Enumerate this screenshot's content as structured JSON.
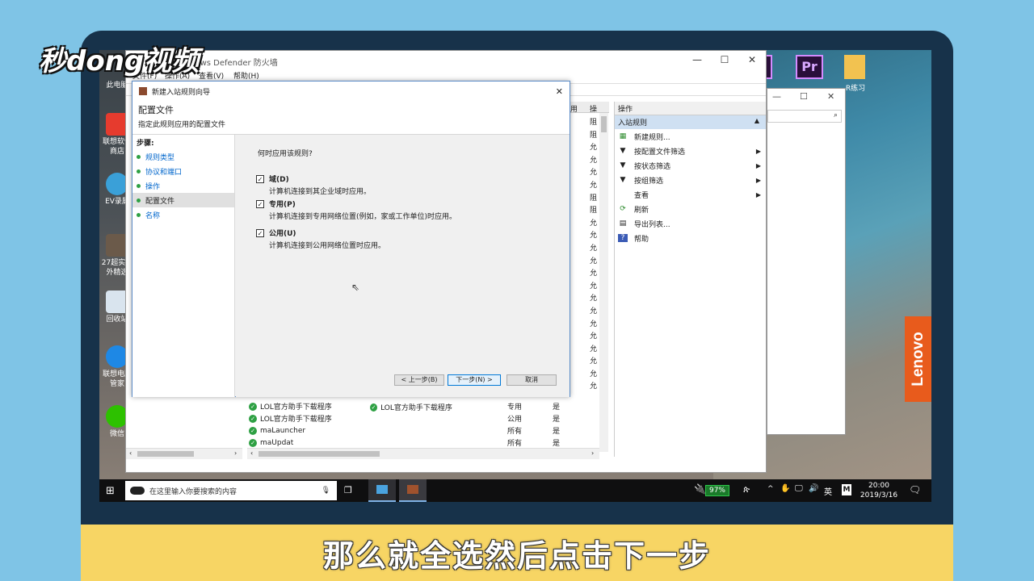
{
  "watermark": "秒dong视频",
  "subtitle": "那么就全选然后点击下一步",
  "brand": "Lenovo",
  "desktop_icons": [
    {
      "label": "此电脑"
    },
    {
      "label": "联想软件商店"
    },
    {
      "label": "EV录屏"
    },
    {
      "label": "27超实用外精选"
    },
    {
      "label": "回收站"
    },
    {
      "label": "联想电脑管家"
    },
    {
      "label": "微信"
    }
  ],
  "pr_icon": "Pr",
  "file_icon_label": "R练习",
  "main_window": {
    "title": "indows Defender 防火墙",
    "menu": [
      "文件(F)",
      "操作(A)",
      "查看(V)",
      "帮助(H)"
    ],
    "controls": {
      "min": "—",
      "max": "☐",
      "close": "✕"
    }
  },
  "actions_pane": {
    "header": "操作",
    "section": "入站规则",
    "items": [
      {
        "label": "新建规则...",
        "icon": "new-rule-icon"
      },
      {
        "label": "按配置文件筛选",
        "icon": "filter-icon",
        "arrow": "▶"
      },
      {
        "label": "按状态筛选",
        "icon": "filter-icon",
        "arrow": "▶"
      },
      {
        "label": "按组筛选",
        "icon": "filter-icon",
        "arrow": "▶"
      },
      {
        "label": "查看",
        "icon": "view-icon",
        "arrow": "▶"
      },
      {
        "label": "刷新",
        "icon": "refresh-icon"
      },
      {
        "label": "导出列表...",
        "icon": "export-icon"
      },
      {
        "label": "帮助",
        "icon": "help-icon"
      }
    ]
  },
  "list_header": {
    "col_a": "用",
    "col_b": "操"
  },
  "list_partial_actions": [
    "阻",
    "阻",
    "允",
    "允",
    "允",
    "允",
    "阻",
    "阻",
    "允",
    "允",
    "允",
    "允",
    "允",
    "允",
    "允",
    "允",
    "允",
    "允",
    "允",
    "允",
    "允",
    "允"
  ],
  "list_rows": [
    {
      "name": "LOL官方助手下载程序",
      "profile": "专用",
      "enabled": "是"
    },
    {
      "name": "LOL官方助手下载程序",
      "profile": "公用",
      "enabled": "是"
    },
    {
      "name": "maLauncher",
      "profile": "所有",
      "enabled": "是"
    },
    {
      "name": "maUpdat",
      "profile": "所有",
      "enabled": "是"
    }
  ],
  "dialog": {
    "title": "新建入站规则向导",
    "heading": "配置文件",
    "subheading": "指定此规则应用的配置文件",
    "steps_label": "步骤:",
    "steps": [
      "规则类型",
      "协议和端口",
      "操作",
      "配置文件",
      "名称"
    ],
    "question": "何时应用该规则?",
    "options": [
      {
        "label": "域(D)",
        "desc": "计算机连接到其企业域时应用。",
        "checked": true
      },
      {
        "label": "专用(P)",
        "desc": "计算机连接到专用网络位置(例如，家或工作单位)时应用。",
        "checked": true
      },
      {
        "label": "公用(U)",
        "desc": "计算机连接到公用网络位置时应用。",
        "checked": true
      }
    ],
    "buttons": {
      "back": "< 上一步(B)",
      "next": "下一步(N) >",
      "cancel": "取消"
    }
  },
  "taskbar": {
    "search_placeholder": "在这里输入你要搜索的内容",
    "battery": "97%",
    "ime": "英",
    "ime2": "M",
    "time": "20:00",
    "date": "2019/3/16"
  }
}
